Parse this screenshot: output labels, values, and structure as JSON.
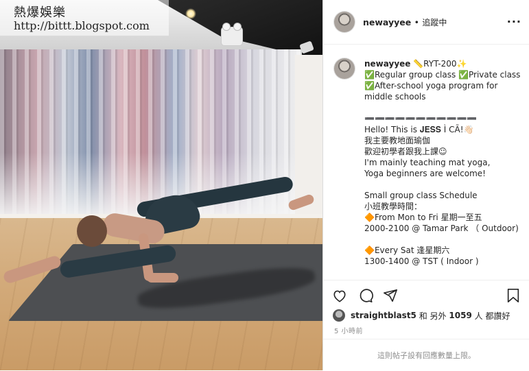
{
  "watermark": {
    "title": "熱爆娛樂",
    "url": "http://bittt.blogspot.com"
  },
  "header": {
    "username": "newayyee",
    "separator": "•",
    "follow_label": "追蹤中",
    "more_icon": "more-horizontal-icon"
  },
  "caption": {
    "username": "newayyee",
    "text": " 📏RYT-200✨\n✅Regular group class ✅Private class\n✅After-school yoga program for middle schools\n\n➖➖➖➖➖➖➖➖➖➖➖\nHello! This is 𝐉𝐄𝐒𝐒 Ì CÃ!👋🏻\n我主要教地面瑜伽\n歡迎初學者跟我上課☺\nI'm mainly teaching mat yoga,\nYoga beginners are welcome!\n\nSmall group class Schedule\n小班教學時間：\n🔶From Mon to Fri 星期一至五\n2000-2100 @ Tamar Park （ Outdoor)\n\n🔶Every Sat 逢星期六\n1300-1400 @ TST ( Indoor )"
  },
  "actions": {
    "like_icon": "heart-icon",
    "comment_icon": "comment-icon",
    "share_icon": "share-icon",
    "save_icon": "bookmark-icon"
  },
  "likes": {
    "user": "straightblast5",
    "connector": "和 另外",
    "count": "1059",
    "suffix": "人 都讚好"
  },
  "timestamp": "5 小時前",
  "comments_disabled": "這則帖子設有回應數量上限。"
}
